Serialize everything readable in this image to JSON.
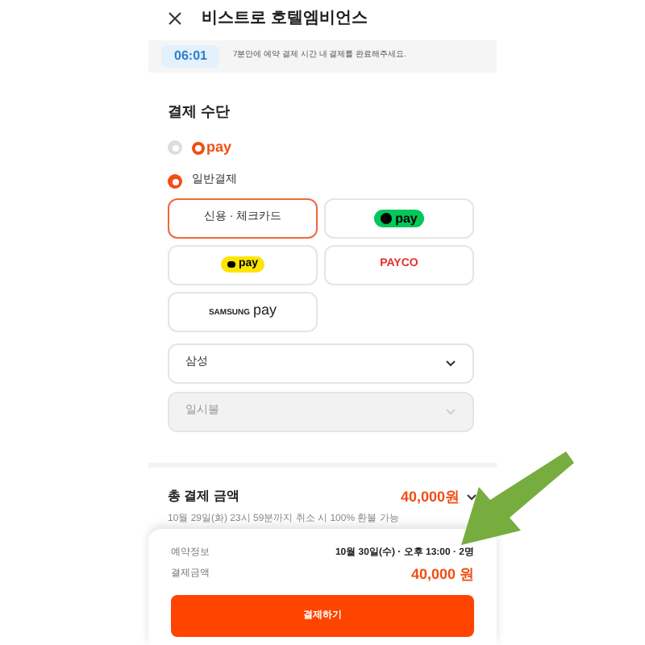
{
  "header": {
    "title": "비스트로 호텔엠비언스"
  },
  "timer": {
    "time": "06:01",
    "message": "7분안에 예약 결제 시간 내 결제를 완료해주세요."
  },
  "payment": {
    "title": "결제 수단",
    "methods": [
      {
        "kind": "epay",
        "label": "pay",
        "selected": false
      },
      {
        "kind": "text",
        "label": "일반결제",
        "selected": true
      }
    ],
    "options": [
      {
        "kind": "text",
        "label": "신용 · 체크카드",
        "selected": true
      },
      {
        "kind": "npay",
        "label": "pay",
        "selected": false
      },
      {
        "kind": "kakao",
        "label": "pay",
        "selected": false
      },
      {
        "kind": "payco",
        "label": "PAYCO",
        "selected": false
      },
      {
        "kind": "samsung",
        "label": "SAMSUNG",
        "label2": "pay",
        "selected": false
      }
    ],
    "selects": [
      {
        "value": "삼성",
        "disabled": false
      },
      {
        "value": "일시불",
        "disabled": true
      }
    ]
  },
  "total": {
    "label": "총 결제 금액",
    "amount": "40,000원",
    "note": "10월 29일(화) 23시 59분까지 취소 시 100% 환불 가능"
  },
  "sheet": {
    "rows": [
      {
        "label": "예약정보",
        "value": "10월 30일(수) · 오후 13:00 · 2명",
        "kind": "info"
      },
      {
        "label": "결제금액",
        "value": "40,000 원",
        "kind": "price"
      }
    ],
    "button": "결제하기"
  }
}
